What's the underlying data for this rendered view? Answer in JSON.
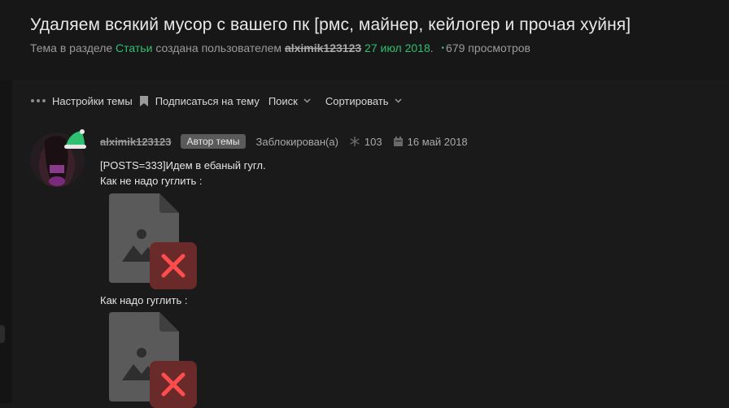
{
  "thread": {
    "title": "Удаляем всякий мусор с вашего пк [рмс, майнер, кейлогер и прочая хуйня]",
    "meta_prefix": "Тема в разделе",
    "section": "Статьи",
    "meta_created": "создана пользователем",
    "author": "alximik123123",
    "date": "27 июл 2018",
    "date_suffix": ".",
    "views": "679 просмотров"
  },
  "toolbar": {
    "settings_label": "Настройки темы",
    "subscribe_label": "Подписаться на тему",
    "search_label": "Поиск",
    "sort_label": "Сортировать"
  },
  "post": {
    "username": "alximik123123",
    "author_badge": "Автор темы",
    "status": "Заблокирован(а)",
    "likes": "103",
    "date": "16 май 2018",
    "lines": [
      "[POSTS=333]Идем в ебаный гугл.",
      "Как не надо гуглить :",
      "Как надо гуглить :"
    ]
  },
  "icons": {
    "dots": "more-dots-icon",
    "bookmark": "bookmark-icon",
    "chevron": "chevron-down-icon",
    "snowflake": "snowflake-icon",
    "calendar": "calendar-icon",
    "broken_image": "broken-image-icon"
  },
  "colors": {
    "background": "#1a1a1a",
    "accent_green": "#2fbf71",
    "error_red": "#ff4d4d",
    "badge_bg": "#5a5a5a"
  }
}
